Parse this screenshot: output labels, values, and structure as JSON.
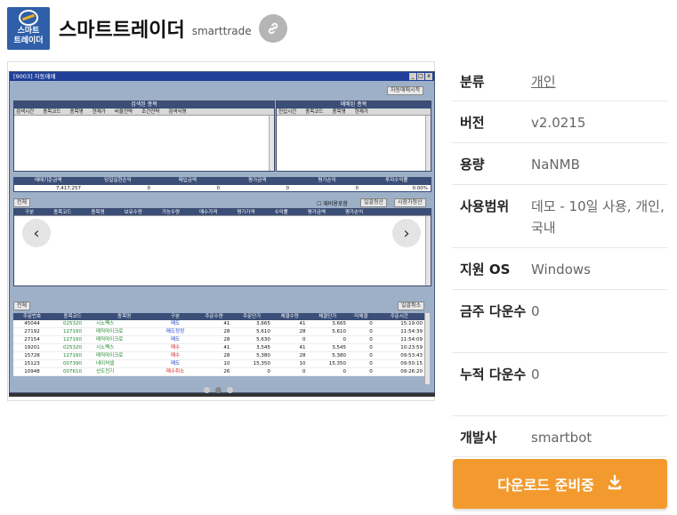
{
  "app": {
    "logo_text": "스마트\n트레이더",
    "title": "스마트트레이더",
    "slug": "smarttrade",
    "link_icon": "link-icon"
  },
  "screenshot": {
    "window_title": "[9003] 자동매매",
    "start_button": "자동매매시작",
    "search_panel": {
      "title": "검색된 종목",
      "columns": [
        "검색시간",
        "종목코드",
        "종목명",
        "현재가",
        "비율전략",
        "조건전략",
        "검색식명"
      ]
    },
    "trade_panel": {
      "title": "매매된 종목",
      "columns": [
        "진입시간",
        "종목코드",
        "종목명",
        "현재가"
      ]
    },
    "summary": {
      "headers": [
        "매매기준금액",
        "당일실현손익",
        "매입금액",
        "평가금액",
        "평가손익",
        "투자수익률"
      ],
      "values": [
        "7,417,257",
        "0",
        "0",
        "0",
        "0",
        "0.00%"
      ]
    },
    "holdings": {
      "all_label": "전체",
      "checkbox_label": "재비용포함",
      "btn_settle": "일괄청산",
      "btn_market": "시장가청산",
      "columns": [
        "구분",
        "종목코드",
        "종목명",
        "보유수량",
        "가능수량",
        "매수가격",
        "평가가격",
        "수익률",
        "평가금액",
        "평가손익"
      ]
    },
    "orders": {
      "all_label": "전체",
      "cancel_all": "일괄취소",
      "columns": [
        "주문번호",
        "종목코드",
        "종목명",
        "구분",
        "주문수량",
        "주문단가",
        "체결수량",
        "체결단가",
        "미체결",
        "주문시간"
      ],
      "rows": [
        {
          "no": "45044",
          "code": "025320",
          "name": "시노펙스",
          "type": "매도",
          "kind": "sell",
          "qty": "41",
          "price": "3,665",
          "fqty": "41",
          "fprice": "3,665",
          "open": "0",
          "time": "15:19:00"
        },
        {
          "no": "27192",
          "code": "127160",
          "name": "매직마이크로",
          "type": "매도정정",
          "kind": "sell",
          "qty": "28",
          "price": "5,610",
          "fqty": "28",
          "fprice": "5,610",
          "open": "0",
          "time": "11:54:39"
        },
        {
          "no": "27154",
          "code": "127160",
          "name": "매직마이크로",
          "type": "매도",
          "kind": "sell",
          "qty": "28",
          "price": "5,630",
          "fqty": "0",
          "fprice": "0",
          "open": "0",
          "time": "11:54:09"
        },
        {
          "no": "19201",
          "code": "025320",
          "name": "시노펙스",
          "type": "매수",
          "kind": "buy",
          "qty": "41",
          "price": "3,545",
          "fqty": "41",
          "fprice": "3,545",
          "open": "0",
          "time": "10:23:59"
        },
        {
          "no": "15728",
          "code": "127160",
          "name": "매직마이크로",
          "type": "매수",
          "kind": "buy",
          "qty": "28",
          "price": "5,380",
          "fqty": "28",
          "fprice": "5,380",
          "open": "0",
          "time": "09:53:43"
        },
        {
          "no": "15123",
          "code": "007390",
          "name": "네이처셀",
          "type": "매도",
          "kind": "sell",
          "qty": "10",
          "price": "15,350",
          "fqty": "10",
          "fprice": "15,350",
          "open": "0",
          "time": "09:50:15"
        },
        {
          "no": "10948",
          "code": "007610",
          "name": "선도전기",
          "type": "매수취소",
          "kind": "buy",
          "qty": "26",
          "price": "0",
          "fqty": "0",
          "fprice": "0",
          "open": "0",
          "time": "09:26:20"
        }
      ]
    },
    "carousel": {
      "prev_icon": "chevron-left-icon",
      "next_icon": "chevron-right-icon",
      "prev": "‹",
      "next": "›",
      "slides": 3,
      "active": 2
    }
  },
  "info": {
    "rows": [
      {
        "key": "분류",
        "value": "개인",
        "link": true
      },
      {
        "key": "버전",
        "value": "v2.0215"
      },
      {
        "key": "용량",
        "value": "NaNMB"
      },
      {
        "key": "사용범위",
        "value": "데모 - 10일 사용, 개인, 국내"
      },
      {
        "key": "지원 OS",
        "value": "Windows"
      },
      {
        "key": "금주 다운수",
        "value": "0"
      },
      {
        "key": "누적 다운수",
        "value": "0"
      },
      {
        "key": "개발사",
        "value": "smartbot"
      }
    ]
  },
  "download": {
    "label": "다운로드 준비중",
    "icon": "download-icon",
    "color": "#f39a2f"
  }
}
